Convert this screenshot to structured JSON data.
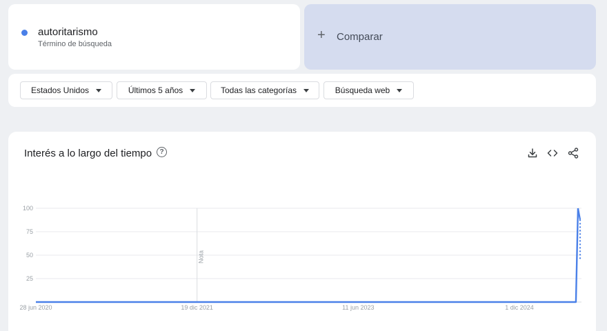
{
  "search_term": {
    "name": "autoritarismo",
    "subtitle": "Término de búsqueda",
    "color": "#4a80e8"
  },
  "compare": {
    "plus": "+",
    "label": "Comparar"
  },
  "filters": [
    {
      "label": "Estados Unidos"
    },
    {
      "label": "Últimos 5 años"
    },
    {
      "label": "Todas las categorías"
    },
    {
      "label": "Búsqueda web"
    }
  ],
  "panel": {
    "title": "Interés a lo largo del tiempo",
    "help_symbol": "?",
    "icons": [
      "download-icon",
      "embed-icon",
      "share-icon"
    ]
  },
  "chart_data": {
    "type": "line",
    "title": "",
    "xlabel": "",
    "ylabel": "",
    "ylim": [
      0,
      100
    ],
    "y_ticks": [
      "100",
      "75",
      "50",
      "25"
    ],
    "x_ticks": [
      "28 jun 2020",
      "19 dic 2021",
      "11 jun 2023",
      "1 dic 2024"
    ],
    "annotation": "Nota",
    "grid": true,
    "series": [
      {
        "color": "#4a80e8",
        "x": [
          "2020-06-28",
          "2021-06-27",
          "2021-12-19",
          "2022-06-26",
          "2023-06-11",
          "2024-06-30",
          "2024-12-01",
          "2025-05-25",
          "2025-06-08",
          "2025-06-15",
          "2025-06-22"
        ],
        "y": [
          0,
          0,
          0,
          0,
          0,
          0,
          0,
          0,
          0,
          100,
          88
        ],
        "partial_last": true
      }
    ]
  }
}
